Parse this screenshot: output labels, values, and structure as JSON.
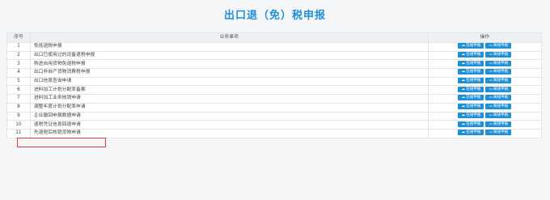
{
  "page_title": "出口退（免）税申报",
  "table": {
    "headers": {
      "index": "序号",
      "item": "业务事项",
      "ops": "操作"
    },
    "rows": [
      {
        "index": "1",
        "item": "免抵退税申报"
      },
      {
        "index": "2",
        "item": "出口已使用过的设备退税申报"
      },
      {
        "index": "3",
        "item": "购进自用货物免退税申报"
      },
      {
        "index": "4",
        "item": "出口非自产货物消费税申报"
      },
      {
        "index": "5",
        "item": "出口信息查询申请"
      },
      {
        "index": "6",
        "item": "进料加工计划分配率备案"
      },
      {
        "index": "7",
        "item": "进料加工业务核销申请"
      },
      {
        "index": "8",
        "item": "调整年度计划分配率申请"
      },
      {
        "index": "9",
        "item": "企业撤回申报数据申请"
      },
      {
        "index": "10",
        "item": "退税凭证信息回退申请"
      },
      {
        "index": "11",
        "item": "先退税后核销货物申请"
      }
    ],
    "buttons": {
      "online": "在线申报",
      "offline": "离线申报"
    }
  },
  "colors": {
    "accent": "#1f8fd6",
    "highlight": "#e03b3b"
  },
  "icons": {
    "online": "cloud-upload-icon",
    "offline": "monitor-icon"
  }
}
